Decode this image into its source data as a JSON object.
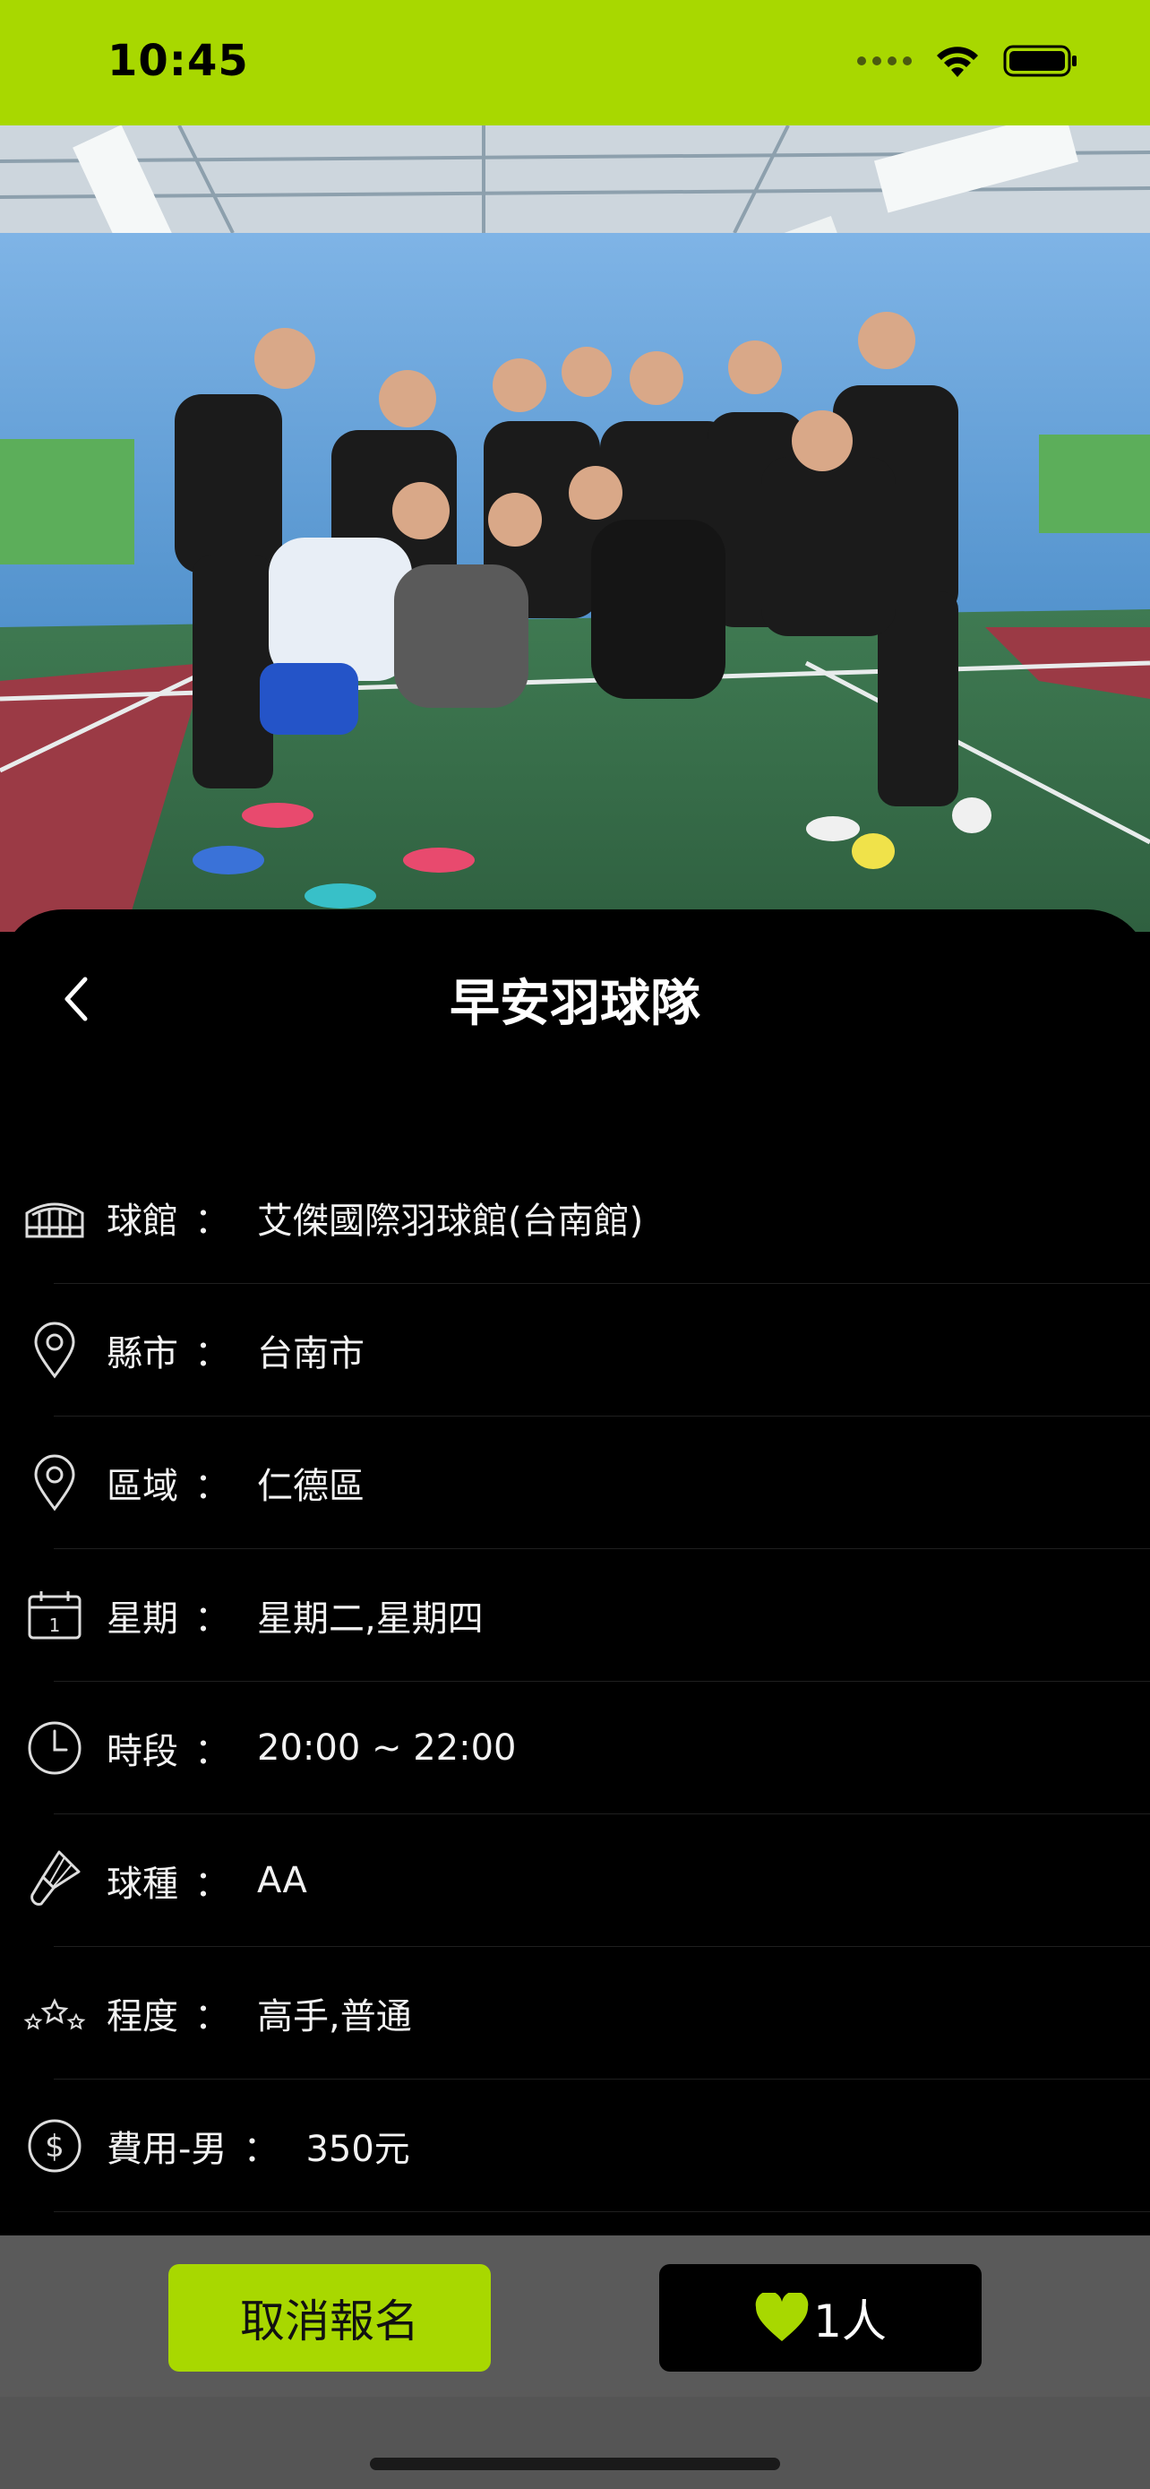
{
  "status": {
    "time": "10:45",
    "bar_color": "#a8d800"
  },
  "hero": {
    "image": "badminton team group photo in indoor court"
  },
  "header": {
    "back_icon": "chevron-left-icon",
    "title": "早安羽球隊"
  },
  "details": [
    {
      "icon": "stadium-icon",
      "label": "球館",
      "colon": "：",
      "value": "艾傑國際羽球館(台南館)"
    },
    {
      "icon": "location-pin-icon",
      "label": "縣市",
      "colon": "：",
      "value": "台南市"
    },
    {
      "icon": "location-pin-icon",
      "label": "區域",
      "colon": "：",
      "value": "仁德區"
    },
    {
      "icon": "calendar-icon",
      "label": "星期",
      "colon": "：",
      "value": "星期二,星期四"
    },
    {
      "icon": "clock-icon",
      "label": "時段",
      "colon": "：",
      "value": "20:00 ~ 22:00"
    },
    {
      "icon": "shuttlecock-icon",
      "label": "球種",
      "colon": "：",
      "value": "AA"
    },
    {
      "icon": "stars-icon",
      "label": "程度",
      "colon": "：",
      "value": "高手,普通"
    },
    {
      "icon": "dollar-icon",
      "label": "費用-男",
      "colon": "：",
      "value": "350元"
    }
  ],
  "actions": {
    "cancel_label": "取消報名",
    "like_count": "1人",
    "accent_color": "#a8d800"
  }
}
